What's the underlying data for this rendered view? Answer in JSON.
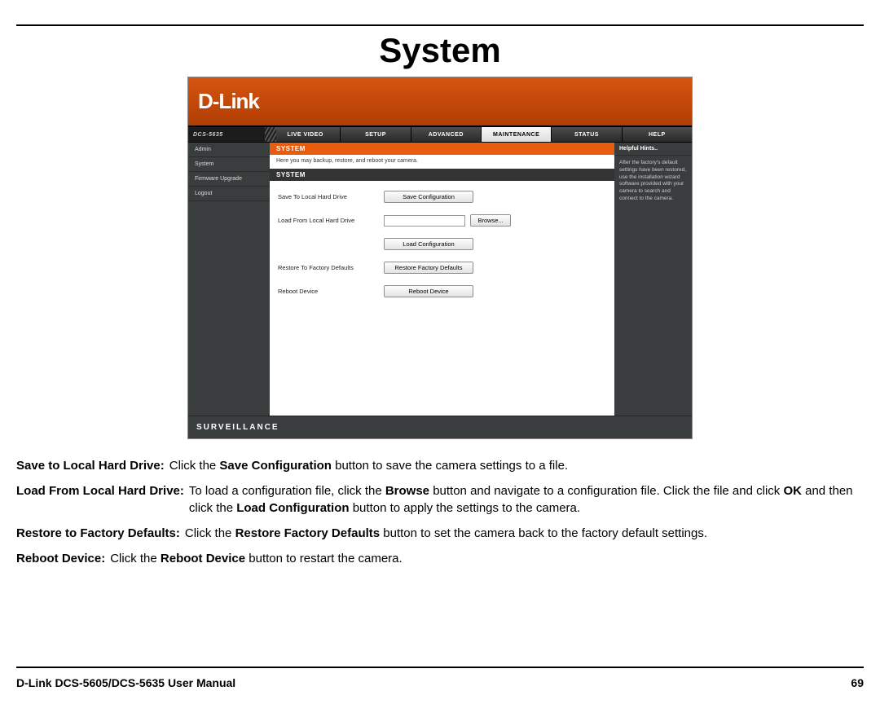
{
  "page": {
    "title": "System",
    "footer_left": "D-Link DCS-5605/DCS-5635 User Manual",
    "footer_right": "69"
  },
  "ui": {
    "logo": "D-Link",
    "model": "DCS-5635",
    "tabs": [
      "LIVE VIDEO",
      "SETUP",
      "ADVANCED",
      "MAINTENANCE",
      "STATUS",
      "HELP"
    ],
    "active_tab_index": 3,
    "sidebar": [
      "Admin",
      "System",
      "Firmware Upgrade",
      "Logout"
    ],
    "section_title": "SYSTEM",
    "section_desc": "Here you may backup, restore, and reboot your camera.",
    "section_bar": "SYSTEM",
    "rows": {
      "save_label": "Save To Local Hard Drive",
      "save_btn": "Save Configuration",
      "load_label": "Load From Local Hard Drive",
      "browse_btn": "Browse...",
      "load_btn": "Load Configuration",
      "restore_label": "Restore To Factory Defaults",
      "restore_btn": "Restore Factory Defaults",
      "reboot_label": "Reboot Device",
      "reboot_btn": "Reboot Device"
    },
    "hints_title": "Helpful Hints..",
    "hints_body": "After the factory's default settings have been restored, use the installation wizard software provided with your camera to search and connect to the camera.",
    "footer_brand": "SURVEILLANCE"
  },
  "descriptions": {
    "save": {
      "term": "Save to Local Hard Drive:",
      "pre": "Click the ",
      "b1": "Save Configuration",
      "post": " button to save the camera settings to a file."
    },
    "load": {
      "term": "Load From Local Hard Drive:",
      "pre": "To load a configuration file, click the ",
      "b1": "Browse",
      "mid": " button and navigate to a configuration file. Click the file and click ",
      "b2": "OK",
      "mid2": " and then click the ",
      "b3": "Load Configuration",
      "post": " button to apply the settings to the camera."
    },
    "restore": {
      "term": "Restore to Factory Defaults:",
      "pre": "Click the ",
      "b1": "Restore Factory Defaults",
      "post": " button to set the camera back to the factory default settings."
    },
    "reboot": {
      "term": "Reboot Device:",
      "pre": "Click the ",
      "b1": "Reboot Device",
      "post": " button to restart the camera."
    }
  }
}
